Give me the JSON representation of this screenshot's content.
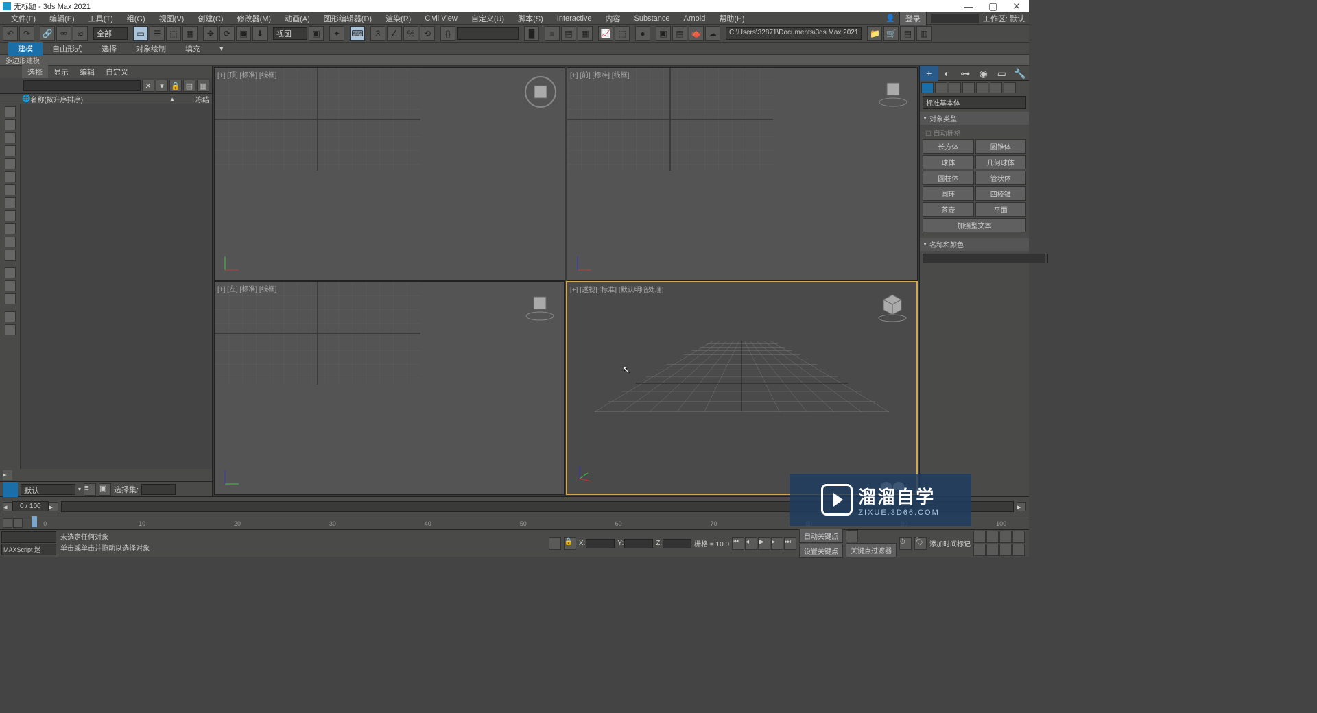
{
  "title_bar": {
    "app_icon": "3",
    "text": "无标题 - 3ds Max 2021"
  },
  "menu_bar": {
    "items": [
      "文件(F)",
      "编辑(E)",
      "工具(T)",
      "组(G)",
      "视图(V)",
      "创建(C)",
      "修改器(M)",
      "动画(A)",
      "图形编辑器(D)",
      "渲染(R)",
      "Civil View",
      "自定义(U)",
      "脚本(S)",
      "Interactive",
      "内容",
      "Substance",
      "Arnold",
      "帮助(H)"
    ],
    "login_label": "登录",
    "workspace_label": "工作区: 默认"
  },
  "toolbar": {
    "selection_filter": "全部",
    "ref_coord": "视图",
    "project_path": "C:\\Users\\32871\\Documents\\3ds Max 2021"
  },
  "ribbon": {
    "tabs": [
      "建模",
      "自由形式",
      "选择",
      "对象绘制",
      "填充"
    ],
    "active_tab": 0,
    "panel_label": "多边形建模"
  },
  "scene_explorer": {
    "tabs": [
      "选择",
      "显示",
      "编辑",
      "自定义"
    ],
    "active_tab": 0,
    "name_col": "名称(按升序排序)",
    "freeze_col": "冻结",
    "default_label": "默认",
    "selection_set_label": "选择集:"
  },
  "viewports": {
    "top_left": "[+] [顶] [标准] [线框]",
    "top_right": "[+] [前] [标准] [线框]",
    "bottom_left": "[+] [左] [标准] [线框]",
    "bottom_right": "[+] [透视] [标准] [默认明暗处理]"
  },
  "command_panel": {
    "category": "标准基本体",
    "rollout_object_type": "对象类型",
    "auto_grid": "自动栅格",
    "buttons": [
      [
        "长方体",
        "圆锥体"
      ],
      [
        "球体",
        "几何球体"
      ],
      [
        "圆柱体",
        "管状体"
      ],
      [
        "圆环",
        "四棱锥"
      ],
      [
        "茶壶",
        "平面"
      ],
      [
        "加强型文本",
        ""
      ]
    ],
    "rollout_name_color": "名称和颜色",
    "color_swatch": "#e6218c"
  },
  "time_slider": {
    "frame_text": "0 / 100"
  },
  "track_bar": {
    "ticks": [
      0,
      10,
      20,
      30,
      40,
      50,
      60,
      70,
      80,
      90,
      100
    ]
  },
  "status_bar": {
    "script_btn1": "",
    "script_btn2": "MAXScript 迷",
    "msg1": "未选定任何对象",
    "msg2": "单击或单击并拖动以选择对象",
    "x_label": "X:",
    "y_label": "Y:",
    "z_label": "Z:",
    "grid_label": "栅格 = 10.0",
    "add_time_tag": "添加时间标记",
    "autokey": "自动关键点",
    "setkey": "设置关键点",
    "keyfilter": "关键点过滤器"
  },
  "watermark": {
    "big": "溜溜自学",
    "small": "ZIXUE.3D66.COM"
  }
}
